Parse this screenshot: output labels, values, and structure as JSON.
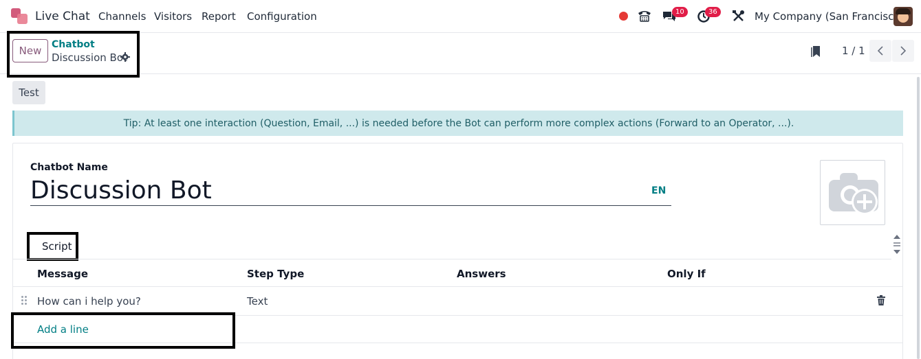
{
  "navbar": {
    "app_name": "Live Chat",
    "menu": [
      "Channels",
      "Visitors",
      "Report",
      "Configuration"
    ],
    "messages_badge": "10",
    "activities_badge": "36",
    "company": "My Company (San Francisco)"
  },
  "control_panel": {
    "new_label": "New",
    "breadcrumb": "Chatbot",
    "record_title": "Discussion Bot",
    "pager_value": "1 / 1"
  },
  "actions": {
    "test_label": "Test"
  },
  "tip": "Tip: At least one interaction (Question, Email, ...) is needed before the Bot can perform more complex actions (Forward to an Operator, ...).",
  "form": {
    "name_label": "Chatbot Name",
    "name_value": "Discussion Bot",
    "lang": "EN"
  },
  "tabs": {
    "script": "Script"
  },
  "table": {
    "headers": [
      "Message",
      "Step Type",
      "Answers",
      "Only If"
    ],
    "rows": [
      {
        "message": "How can i help you?",
        "step_type": "Text",
        "answers": "",
        "only_if": ""
      }
    ],
    "add_line": "Add a line"
  },
  "colors": {
    "brand": "#875a7b",
    "link": "#017e84",
    "tip_bg": "#cfe9ec",
    "badge": "#e11d48",
    "recording": "#e53935"
  },
  "icons": [
    "app-logo-icon",
    "recording-dot-icon",
    "phone-icon",
    "chat-icon",
    "clock-icon",
    "tools-icon",
    "gear-icon",
    "bookmark-icon",
    "chevron-left-icon",
    "chevron-right-icon",
    "camera-plus-icon",
    "drag-handle-icon",
    "trash-icon"
  ]
}
